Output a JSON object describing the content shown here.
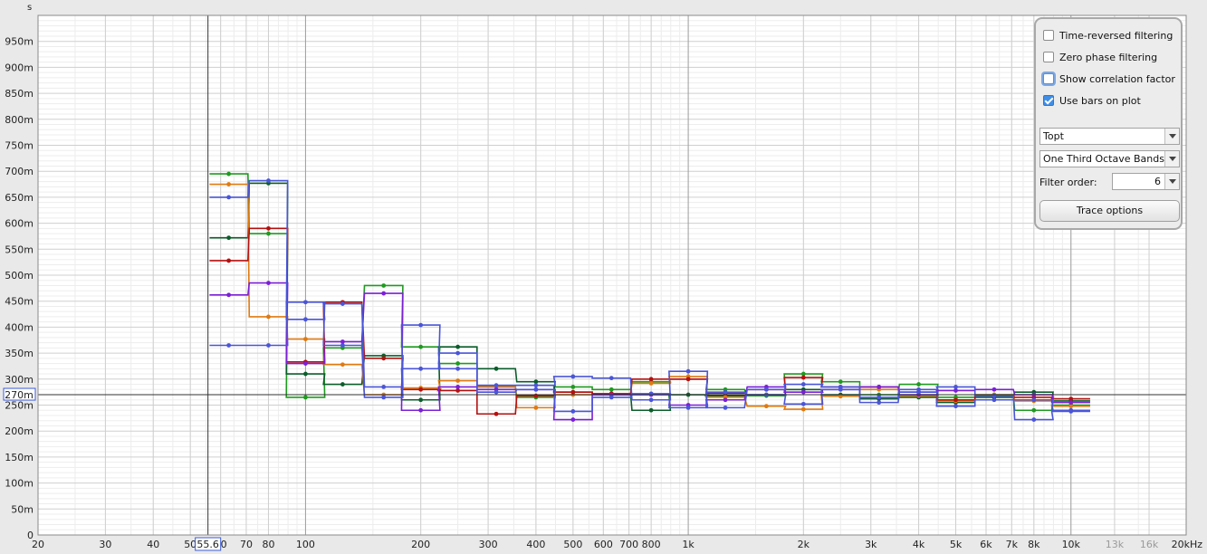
{
  "axis": {
    "y_unit": "s",
    "x_unit": "Hz",
    "cursor_y_label": "270m",
    "cursor_x_label": "55.6"
  },
  "chart_data": {
    "type": "line",
    "style": "stepped bars (one-third octave bands)",
    "xscale": "log",
    "xlim": [
      20,
      20000
    ],
    "ylim": [
      0,
      1.0
    ],
    "grid": true,
    "cursor": {
      "x": 55.6,
      "y": 0.27
    },
    "y_ticks": [
      {
        "v": 0,
        "label": "0"
      },
      {
        "v": 0.05,
        "label": "50m"
      },
      {
        "v": 0.1,
        "label": "100m"
      },
      {
        "v": 0.15,
        "label": "150m"
      },
      {
        "v": 0.2,
        "label": "200m"
      },
      {
        "v": 0.25,
        "label": "250m"
      },
      {
        "v": 0.3,
        "label": "300m"
      },
      {
        "v": 0.35,
        "label": "350m"
      },
      {
        "v": 0.4,
        "label": "400m"
      },
      {
        "v": 0.45,
        "label": "450m"
      },
      {
        "v": 0.5,
        "label": "500m"
      },
      {
        "v": 0.55,
        "label": "550m"
      },
      {
        "v": 0.6,
        "label": "600m"
      },
      {
        "v": 0.65,
        "label": "650m"
      },
      {
        "v": 0.7,
        "label": "700m"
      },
      {
        "v": 0.75,
        "label": "750m"
      },
      {
        "v": 0.8,
        "label": "800m"
      },
      {
        "v": 0.85,
        "label": "850m"
      },
      {
        "v": 0.9,
        "label": "900m"
      },
      {
        "v": 0.95,
        "label": "950m"
      }
    ],
    "x_ticks": [
      {
        "v": 20,
        "label": "20",
        "minor": false
      },
      {
        "v": 30,
        "label": "30",
        "minor": false
      },
      {
        "v": 40,
        "label": "40",
        "minor": false
      },
      {
        "v": 50,
        "label": "50",
        "minor": false
      },
      {
        "v": 60,
        "label": "60",
        "minor": false
      },
      {
        "v": 70,
        "label": "70",
        "minor": false
      },
      {
        "v": 80,
        "label": "80",
        "minor": false
      },
      {
        "v": 100,
        "label": "100",
        "minor": false
      },
      {
        "v": 200,
        "label": "200",
        "minor": false
      },
      {
        "v": 300,
        "label": "300",
        "minor": false
      },
      {
        "v": 400,
        "label": "400",
        "minor": false
      },
      {
        "v": 500,
        "label": "500",
        "minor": false
      },
      {
        "v": 600,
        "label": "600",
        "minor": false
      },
      {
        "v": 700,
        "label": "700",
        "minor": false
      },
      {
        "v": 800,
        "label": "800",
        "minor": false
      },
      {
        "v": 1000,
        "label": "1k",
        "minor": false
      },
      {
        "v": 2000,
        "label": "2k",
        "minor": false
      },
      {
        "v": 3000,
        "label": "3k",
        "minor": false
      },
      {
        "v": 4000,
        "label": "4k",
        "minor": false
      },
      {
        "v": 5000,
        "label": "5k",
        "minor": false
      },
      {
        "v": 6000,
        "label": "6k",
        "minor": false
      },
      {
        "v": 7000,
        "label": "7k",
        "minor": false
      },
      {
        "v": 8000,
        "label": "8k",
        "minor": false
      },
      {
        "v": 10000,
        "label": "10k",
        "minor": false
      },
      {
        "v": 13000,
        "label": "13k",
        "minor": true
      },
      {
        "v": 16000,
        "label": "16k",
        "minor": true
      },
      {
        "v": 20000,
        "label": "20kHz",
        "minor": false
      }
    ],
    "bands": [
      63,
      80,
      100,
      125,
      160,
      200,
      250,
      315,
      400,
      500,
      630,
      800,
      1000,
      1250,
      1600,
      2000,
      2500,
      3150,
      4000,
      5000,
      6300,
      8000,
      10000
    ],
    "series": [
      {
        "color": "#1f9a1f",
        "values": [
          0.695,
          0.58,
          0.265,
          0.36,
          0.48,
          0.362,
          0.33,
          0.285,
          0.265,
          0.285,
          0.28,
          0.295,
          0.3,
          0.28,
          0.268,
          0.31,
          0.295,
          0.27,
          0.29,
          0.265,
          0.27,
          0.24,
          0.25
        ]
      },
      {
        "color": "#0b5d2a",
        "values": [
          0.572,
          0.677,
          0.31,
          0.29,
          0.345,
          0.26,
          0.362,
          0.32,
          0.295,
          0.275,
          0.27,
          0.24,
          0.27,
          0.268,
          0.27,
          0.28,
          0.27,
          0.262,
          0.265,
          0.255,
          0.265,
          0.275,
          0.258
        ]
      },
      {
        "color": "#e07a10",
        "values": [
          0.675,
          0.42,
          0.377,
          0.328,
          0.27,
          0.283,
          0.297,
          0.285,
          0.245,
          0.27,
          0.272,
          0.292,
          0.305,
          0.265,
          0.248,
          0.242,
          0.267,
          0.28,
          0.268,
          0.258,
          0.27,
          0.258,
          0.248
        ]
      },
      {
        "color": "#b51010",
        "values": [
          0.528,
          0.59,
          0.333,
          0.448,
          0.34,
          0.28,
          0.278,
          0.233,
          0.268,
          0.275,
          0.272,
          0.3,
          0.3,
          0.273,
          0.28,
          0.303,
          0.285,
          0.285,
          0.275,
          0.26,
          0.268,
          0.265,
          0.262
        ]
      },
      {
        "color": "#7b1fd6",
        "values": [
          0.462,
          0.485,
          0.33,
          0.372,
          0.465,
          0.24,
          0.285,
          0.28,
          0.28,
          0.222,
          0.27,
          0.27,
          0.25,
          0.26,
          0.285,
          0.275,
          0.28,
          0.285,
          0.27,
          0.278,
          0.28,
          0.27,
          0.255
        ]
      },
      {
        "color": "#4a55d8",
        "values": [
          0.65,
          0.682,
          0.415,
          0.445,
          0.285,
          0.404,
          0.32,
          0.288,
          0.288,
          0.305,
          0.302,
          0.26,
          0.315,
          0.245,
          0.28,
          0.29,
          0.285,
          0.265,
          0.28,
          0.285,
          0.268,
          0.222,
          0.238
        ]
      },
      {
        "color": "#4a55d8",
        "values": [
          0.365,
          0.365,
          0.448,
          0.365,
          0.265,
          0.32,
          0.35,
          0.275,
          0.28,
          0.238,
          0.265,
          0.272,
          0.245,
          0.275,
          0.27,
          0.252,
          0.28,
          0.255,
          0.275,
          0.248,
          0.26,
          0.26,
          0.24
        ]
      }
    ]
  },
  "panel": {
    "checkboxes": [
      {
        "label": "Time-reversed filtering",
        "checked": false,
        "focus": false
      },
      {
        "label": "Zero phase filtering",
        "checked": false,
        "focus": false
      },
      {
        "label": "Show correlation factor",
        "checked": false,
        "focus": true
      },
      {
        "label": "Use bars on plot",
        "checked": true,
        "focus": false
      }
    ],
    "metric_select": "Topt",
    "band_select": "One Third Octave Bands",
    "filter_order_label": "Filter order:",
    "filter_order_value": "6",
    "trace_button": "Trace options"
  }
}
